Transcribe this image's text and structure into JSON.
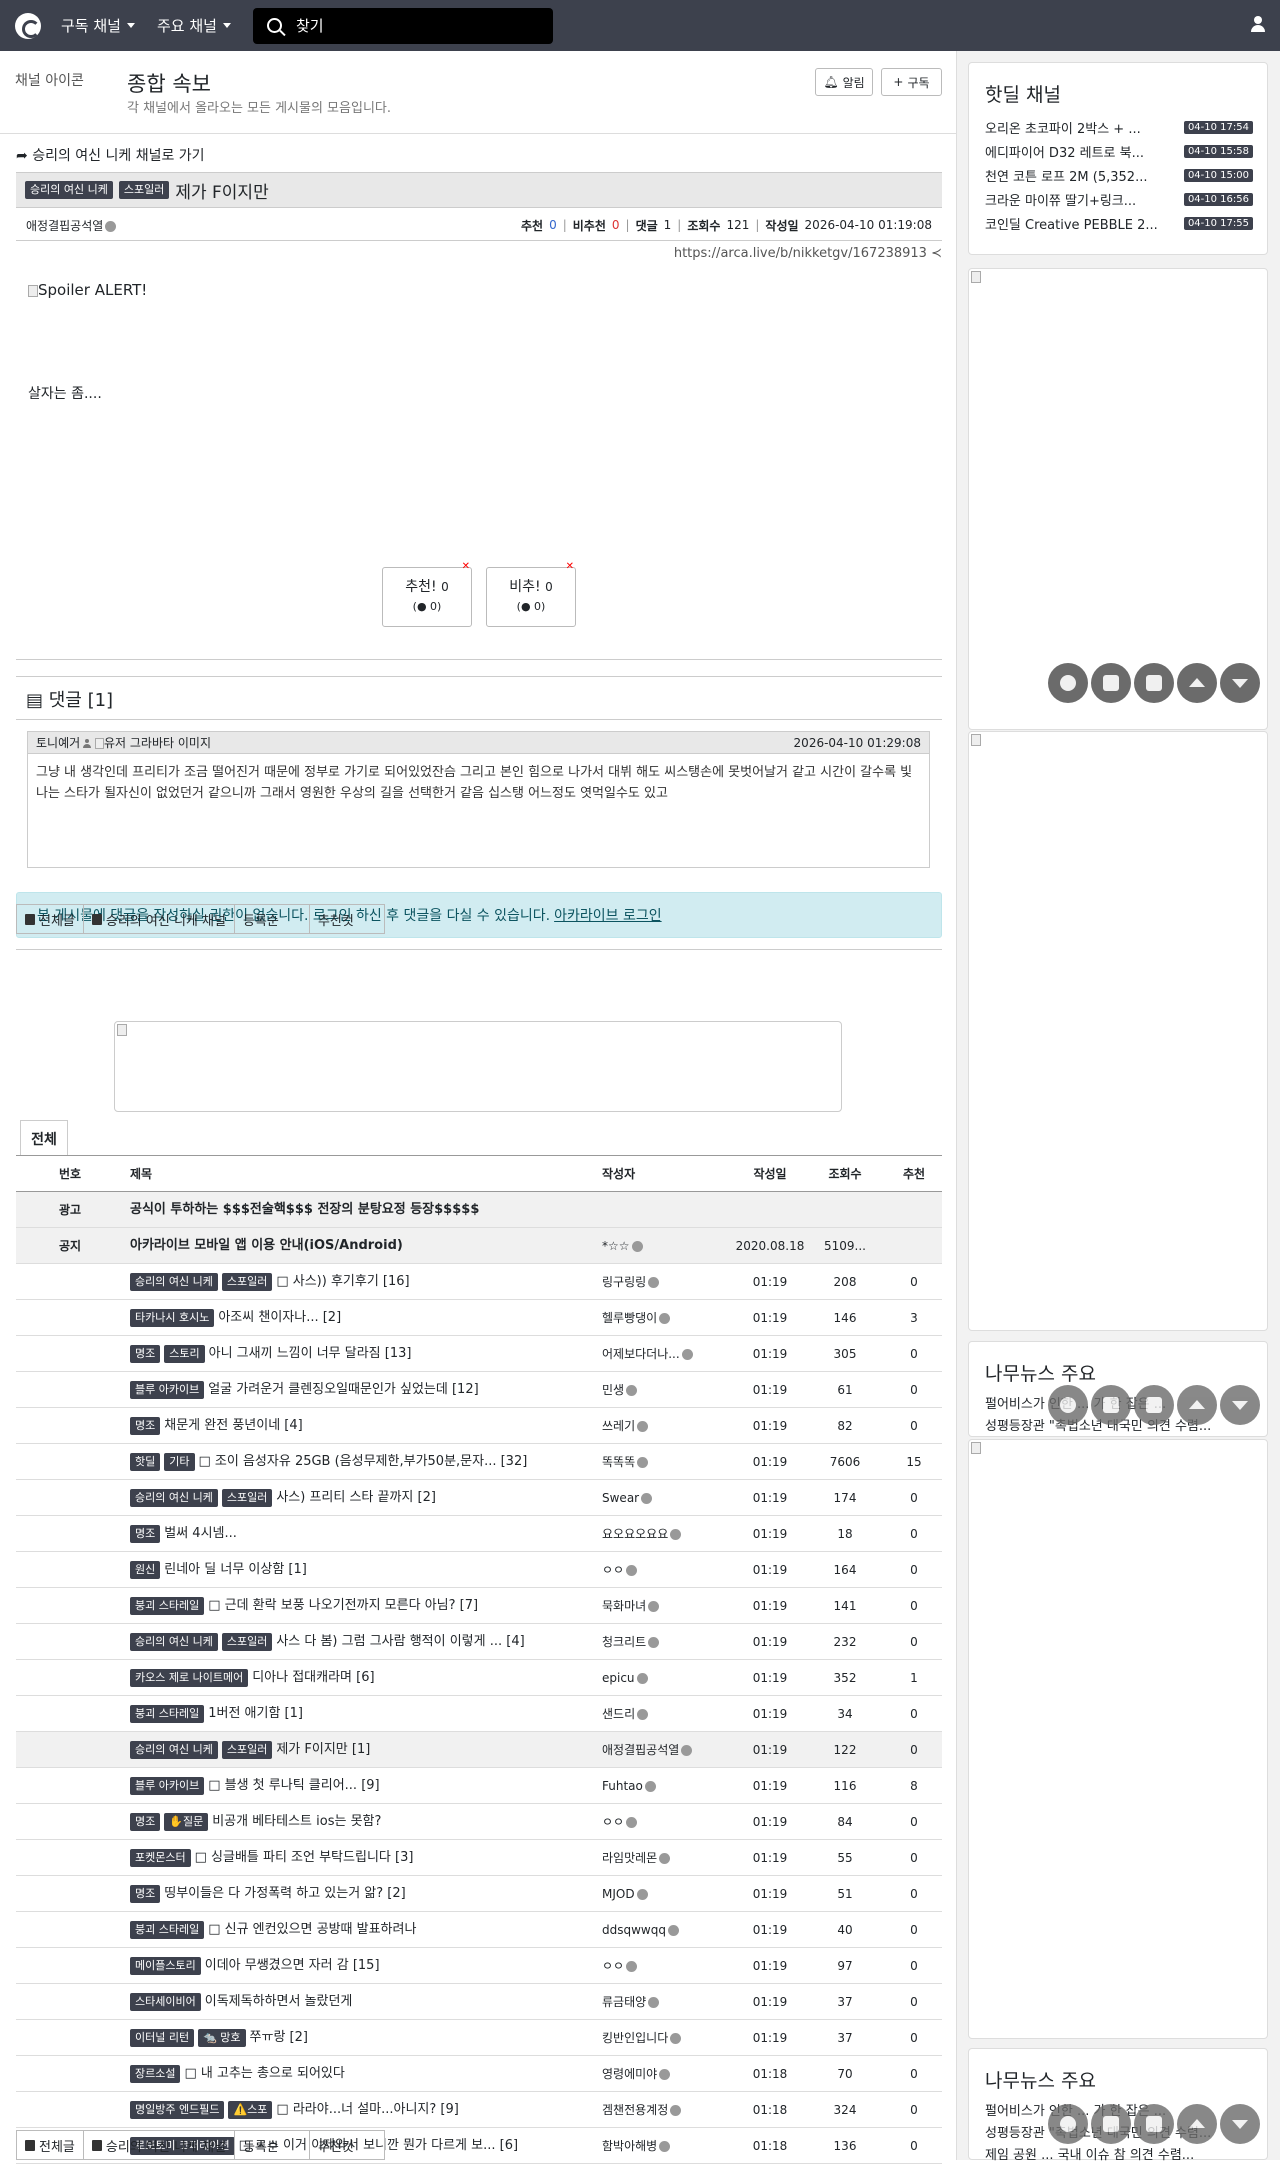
{
  "nav": {
    "subscribed": "구독 채널",
    "main": "주요 채널",
    "search_placeholder": "찾기"
  },
  "header": {
    "channel_image_alt": "채널 아이콘",
    "title": "종합 속보",
    "desc": "각 채널에서 올라오는 모든 게시물의 모음입니다.",
    "alarm": "알림",
    "subscribe": "구독"
  },
  "post": {
    "goto": "승리의 여신 니케 채널로 가기",
    "badge1": "승리의 여신 니케",
    "badge2": "스포일러",
    "title": "제가 F이지만",
    "author": "애정결핍공석열",
    "rec_label": "추천",
    "rec": "0",
    "unrec_label": "비추천",
    "unrec": "0",
    "cmt_label": "댓글",
    "cmt": "1",
    "views_label": "조회수",
    "views": "121",
    "date_label": "작성일",
    "date": "2026-04-10 01:19:08",
    "url": "https://arca.live/b/nikketgv/167238913",
    "img_alt": "Spoiler ALERT!",
    "text": "살자는 좀....",
    "vote_up": "추천!",
    "vote_up_count": "0",
    "vote_up_sub": "(",
    "vote_up_sub2": " 0)",
    "vote_down": "비추!",
    "vote_down_count": "0",
    "vote_down_sub": "(",
    "vote_down_sub2": " 0)"
  },
  "comments": {
    "header": "댓글 [1]",
    "items": [
      {
        "author": "토니예거",
        "avatar_alt": "유저 그라바타 이미지",
        "date": "2026-04-10 01:29:08",
        "text": "그냥 내 생각인데 프리티가 조금 떨어진거 때문에 정부로 가기로 되어있었잔슴 그리고 본인 힘으로 나가서 대뷔 해도 씨스탱손에 못벗어날거 같고 시간이 갈수록 빛나는 스타가 될자신이 없었던거 같으니까 그래서 영원한 우상의 길을 선택한거 같음 십스탱 어느정도 엿먹일수도 있고"
      }
    ],
    "no_permission": "본 게시물에 댓글을 작성하실 권한이 없습니다. 로그인 하신 후 댓글을 다실 수 있습니다.",
    "login_link": "아카라이브 로그인"
  },
  "list_tabs": {
    "all": "전체글",
    "channel": "승리의 여신 니케 채널",
    "sort": "등록순",
    "best": "추천컷"
  },
  "board": {
    "tab": "전체",
    "columns": [
      "번호",
      "제목",
      "작성자",
      "작성일",
      "조회수",
      "추천"
    ],
    "ad_row": {
      "no": "광고",
      "title": "공식이 투하하는 $$$전술핵$$$ 전장의 분탕요정 등장$$$$$"
    },
    "notice_row": {
      "no": "공지",
      "title": "아카라이브 모바일 앱 이용 안내(iOS/Android)",
      "author": "*☆☆",
      "date": "2020.08.18",
      "views": "5109..."
    },
    "rows": [
      {
        "badges": [
          "승리의 여신 니케",
          "스포일러"
        ],
        "title": "□ 사스)) 후기후기 [16]",
        "author": "링구링링",
        "date": "01:19",
        "views": "208",
        "rec": "0"
      },
      {
        "badges": [
          "타카나시 호시노"
        ],
        "title": "아조씨 챈이자나... [2]",
        "author": "헬루빵댕이",
        "date": "01:19",
        "views": "146",
        "rec": "3"
      },
      {
        "badges": [
          "명조",
          "스토리"
        ],
        "title": "아니 그새끼 느낌이 너무 달라짐 [13]",
        "author": "어제보다더나...",
        "date": "01:19",
        "views": "305",
        "rec": "0"
      },
      {
        "badges": [
          "블루 아카이브"
        ],
        "title": "얼굴 가려운거 클렌징오일때문인가 싶었는데 [12]",
        "author": "민생",
        "date": "01:19",
        "views": "61",
        "rec": "0"
      },
      {
        "badges": [
          "명조"
        ],
        "title": "채문게 완전 풍년이네 [4]",
        "author": "쓰레기",
        "date": "01:19",
        "views": "82",
        "rec": "0"
      },
      {
        "badges": [
          "핫딜",
          "기타"
        ],
        "title": "□ 조이 음성자유 25GB (음성무제한,부가50분,문자... [32]",
        "author": "똑똑똑",
        "date": "01:19",
        "views": "7606",
        "rec": "15"
      },
      {
        "badges": [
          "승리의 여신 니케",
          "스포일러"
        ],
        "title": "사스) 프리티 스타 끝까지 [2]",
        "author": "Swear",
        "date": "01:19",
        "views": "174",
        "rec": "0"
      },
      {
        "badges": [
          "명조"
        ],
        "title": "벌써 4시넴...",
        "author": "요오요오요요",
        "date": "01:19",
        "views": "18",
        "rec": "0"
      },
      {
        "badges": [
          "원신"
        ],
        "title": "린네아 딜 너무 이상함 [1]",
        "author": "ㅇㅇ",
        "date": "01:19",
        "views": "164",
        "rec": "0"
      },
      {
        "badges": [
          "붕괴 스타레일"
        ],
        "title": "□ 근데 환락 보풍 나오기전까지 모른다 아님? [7]",
        "author": "묵화마녀",
        "date": "01:19",
        "views": "141",
        "rec": "0"
      },
      {
        "badges": [
          "승리의 여신 니케",
          "스포일러"
        ],
        "title": "사스 다 봄) 그럼 그사람 행적이 이렇게 ... [4]",
        "author": "청크리트",
        "date": "01:19",
        "views": "232",
        "rec": "0"
      },
      {
        "badges": [
          "카오스 제로 나이트메어"
        ],
        "title": "디아나 접대캐라며 [6]",
        "author": "epicu",
        "date": "01:19",
        "views": "352",
        "rec": "1"
      },
      {
        "badges": [
          "붕괴 스타레일"
        ],
        "title": "1버전 애기함 [1]",
        "author": "샌드리",
        "date": "01:19",
        "views": "34",
        "rec": "0"
      },
      {
        "badges": [
          "승리의 여신 니케",
          "스포일러"
        ],
        "title": "제가 F이지만 [1]",
        "author": "애정결핍공석열",
        "date": "01:19",
        "views": "122",
        "rec": "0",
        "current": true
      },
      {
        "badges": [
          "블루 아카이브"
        ],
        "title": "□ 블생 첫 루나틱 클리어... [9]",
        "author": "Fuhtao",
        "date": "01:19",
        "views": "116",
        "rec": "8"
      },
      {
        "badges": [
          "명조",
          "✋질문"
        ],
        "title": "비공개 베타테스트 ios는 못함?",
        "author": "ㅇㅇ",
        "date": "01:19",
        "views": "84",
        "rec": "0"
      },
      {
        "badges": [
          "포켓몬스터"
        ],
        "title": "□ 싱글배틀 파티 조언 부탁드립니다 [3]",
        "author": "라임맛레몬",
        "date": "01:19",
        "views": "55",
        "rec": "0"
      },
      {
        "badges": [
          "명조"
        ],
        "title": "띵부이들은 다 가정폭력 하고 있는거 앎? [2]",
        "author": "MJOD",
        "date": "01:19",
        "views": "51",
        "rec": "0"
      },
      {
        "badges": [
          "붕괴 스타레일"
        ],
        "title": "□ 신규 엔컨있으면 공방때 발표하려나",
        "author": "ddsqwwqq",
        "date": "01:19",
        "views": "40",
        "rec": "0"
      },
      {
        "badges": [
          "메이플스토리"
        ],
        "title": "이데아 무쌩겼으면 자러 감 [15]",
        "author": "ㅇㅇ",
        "date": "01:19",
        "views": "97",
        "rec": "0"
      },
      {
        "badges": [
          "스타세이비어"
        ],
        "title": "이독제독하하면서 놀랐던게",
        "author": "류금태양",
        "date": "01:19",
        "views": "37",
        "rec": "0"
      },
      {
        "badges": [
          "이터널 리턴",
          "🐀 망호"
        ],
        "title": "쭈ㅠ랑 [2]",
        "author": "킹반인입니다",
        "date": "01:19",
        "views": "37",
        "rec": "0"
      },
      {
        "badges": [
          "장르소설"
        ],
        "title": "□ 내 고추는 총으로 되어있다",
        "author": "영령에미야",
        "date": "01:18",
        "views": "70",
        "rec": "0"
      },
      {
        "badges": [
          "명일방주 엔드필드",
          "⚠️스포"
        ],
        "title": "□ 라라야...너 설마...아니지? [9]",
        "author": "겜챈전용계정",
        "date": "01:18",
        "views": "324",
        "rec": "0"
      },
      {
        "badges": [
          "로보토미 코퍼레이션"
        ],
        "title": "□ ㅅㅂ 이거 이제와서 보니깐 뭔가 다르게 보... [6]",
        "author": "함박아해병",
        "date": "01:18",
        "views": "136",
        "rec": "0"
      }
    ]
  },
  "sidebar": {
    "hotdeal_title": "핫딜 채널",
    "deals": [
      {
        "name": "오리온 초코파이 2박스 + ...",
        "time": "04-10 17:54"
      },
      {
        "name": "에디파이어 D32 레트로 북...",
        "time": "04-10 15:58"
      },
      {
        "name": "천연 코튼 로프 2M (5,352...",
        "time": "04-10 15:00"
      },
      {
        "name": "크라운 마이쮸 딸기+링크...",
        "time": "04-10 16:56"
      },
      {
        "name": "코인딜 Creative PEBBLE 2...",
        "time": "04-10 17:55"
      }
    ],
    "news_title": "나무뉴스 주요",
    "news": [
      "펄어비스가 인한 ... 가 한 잡은 ...",
      "성평등장관 \"촉법소년 대국민 의견 수렴..."
    ],
    "news2_title": "나무뉴스 주요",
    "news2": [
      "펄어비스가 인한 ... 가 한 잡은 ...",
      "성평등장관 \"촉법소년 대국민 의견 수렴...",
      "제임 공원 ... 국내 이슈 참 의견 수렴..."
    ]
  }
}
